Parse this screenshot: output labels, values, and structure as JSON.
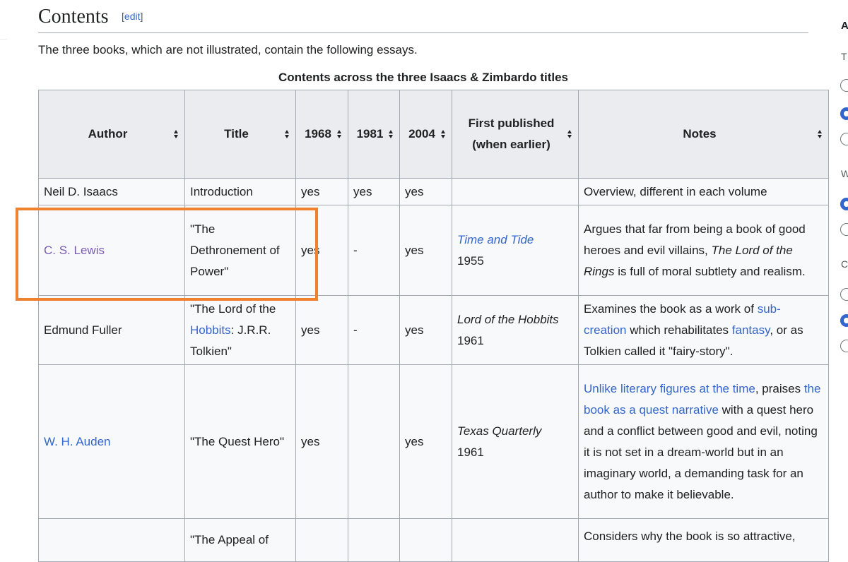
{
  "section": {
    "title": "Contents",
    "edit_open": "[",
    "edit_label": "edit",
    "edit_close": "]"
  },
  "intro": "The three books, which are not illustrated, contain the following essays.",
  "table": {
    "caption": "Contents across the three Isaacs & Zimbardo titles",
    "headers": {
      "author": "Author",
      "title": "Title",
      "y1968": "1968",
      "y1981": "1981",
      "y2004": "2004",
      "first_published": "First published (when earlier)",
      "notes": "Notes"
    },
    "rows": [
      {
        "author": "Neil D. Isaacs",
        "title": "Introduction",
        "y1968": "yes",
        "y1981": "yes",
        "y2004": "yes",
        "first_published": "",
        "notes": "Overview, different in each volume"
      },
      {
        "author": "C. S. Lewis",
        "title": "\"The Dethronement of Power\"",
        "y1968": "yes",
        "y1981": "-",
        "y2004": "yes",
        "pub_name": "Time and Tide",
        "pub_year": "1955",
        "notes_a": "Argues that far from being a book of good heroes and evil villains, ",
        "notes_b": "The Lord of the Rings",
        "notes_c": " is full of moral subtlety and realism."
      },
      {
        "title_a": "\"The Lord of the ",
        "title_link": "Hobbits",
        "title_b": ": J.R.R. Tolkien\"",
        "author": "Edmund Fuller",
        "y1968": "yes",
        "y1981": "-",
        "y2004": "yes",
        "pub_name": "Lord of the Hobbits",
        "pub_year": " 1961",
        "notes_a": "Examines the book as a work of ",
        "notes_link1": "sub-creation",
        "notes_b": " which rehabilitates ",
        "notes_link2": "fantasy",
        "notes_c": ", or as Tolkien called it \"fairy-story\"."
      },
      {
        "author": "W. H. Auden",
        "title": "\"The Quest Hero\"",
        "y1968": "yes",
        "y1981": "",
        "y2004": "yes",
        "pub_name": "Texas Quarterly",
        "pub_year": "1961",
        "notes_link1": "Unlike literary figures at the time",
        "notes_a": ", praises ",
        "notes_link2": "the book as a quest narrative",
        "notes_b": " with a quest hero and a conflict between good and evil, noting it is not set in a dream-world but in an imaginary world, a demanding task for an author to make it believable."
      },
      {
        "title": "\"The Appeal of",
        "notes": "Considers why the book is so attractive,"
      }
    ]
  },
  "sidebar": {
    "heading": "A",
    "label_t": "T",
    "label_w": "W",
    "label_c": "C"
  },
  "colors": {
    "link": "#3366cc",
    "visited_link": "#795cb2",
    "highlight": "#f0812e",
    "header_bg": "#eaecf0",
    "cell_bg": "#f8f9fa"
  }
}
